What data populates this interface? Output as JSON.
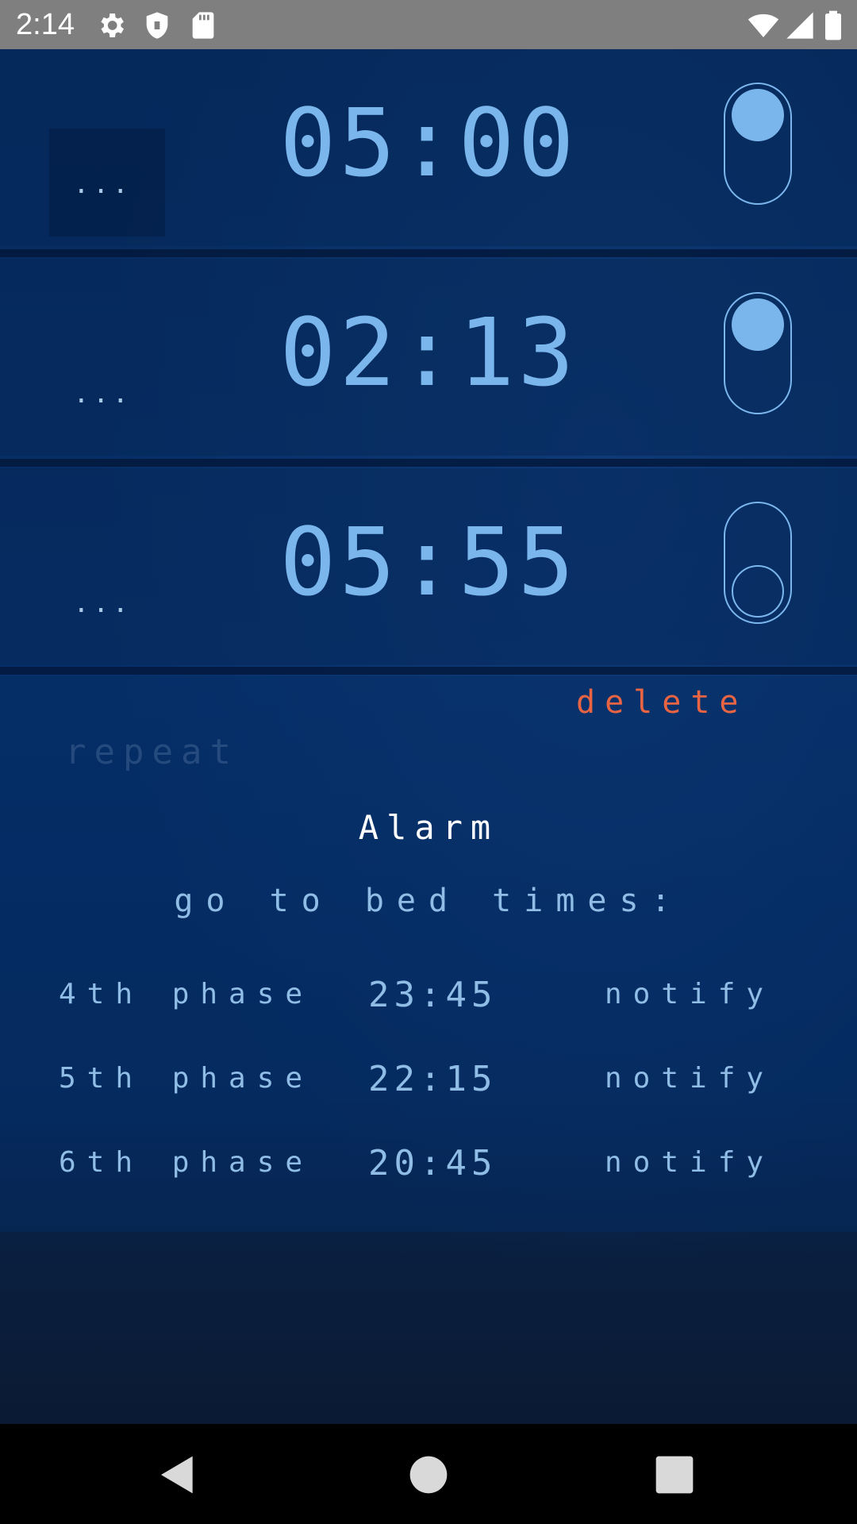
{
  "status_bar": {
    "time": "2:14",
    "icons": [
      "gear-icon",
      "shield-icon",
      "sd-card-icon",
      "wifi-icon",
      "signal-icon",
      "battery-icon"
    ]
  },
  "alarms": [
    {
      "time": "05:00",
      "enabled": true,
      "more_label": "..."
    },
    {
      "time": "02:13",
      "enabled": true,
      "more_label": "..."
    },
    {
      "time": "05:55",
      "enabled": false,
      "more_label": "..."
    }
  ],
  "editor": {
    "delete_label": "delete",
    "repeat_label": "repeat",
    "alarm_label": "Alarm",
    "bed_times_title": "go to bed times:",
    "phases": [
      {
        "name": "4th phase",
        "time": "23:45",
        "action": "notify"
      },
      {
        "name": "5th phase",
        "time": "22:15",
        "action": "notify"
      },
      {
        "name": "6th phase",
        "time": "20:45",
        "action": "notify"
      }
    ]
  },
  "nav_bar": {
    "buttons": [
      "back-icon",
      "home-icon",
      "recents-icon"
    ]
  },
  "colors": {
    "accent": "#7ab6ec",
    "delete": "#e96443",
    "background": "#062a5c"
  }
}
